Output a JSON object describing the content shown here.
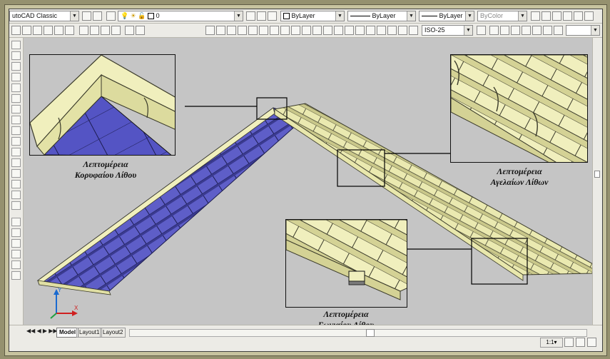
{
  "toolbar": {
    "workspace": "utoCAD Classic",
    "layer": "0",
    "color": "ByLayer",
    "linetype": "ByLayer",
    "lineweight": "ByLayer",
    "plotstyle": "ByColor",
    "dimstyle": "ISO-25"
  },
  "tabs": [
    "Model",
    "Layout1",
    "Layout2"
  ],
  "insets": [
    {
      "line1": "Λεπτομέρεια",
      "line2": "Κορυφαίου Λίθου"
    },
    {
      "line1": "Λεπτομέρεια",
      "line2": "Αγελαίων Λίθων"
    },
    {
      "line1": "Λεπτομέρεια",
      "line2": "Γωνιαίου Λίθου"
    }
  ],
  "ucs": {
    "x_label": "X",
    "y_label": "Y"
  },
  "colors": {
    "tile_blue": "#5e5ec8",
    "tile_cream": "#eae9b0",
    "canvas": "#c5c5c5",
    "frame": "#c7c39f"
  }
}
